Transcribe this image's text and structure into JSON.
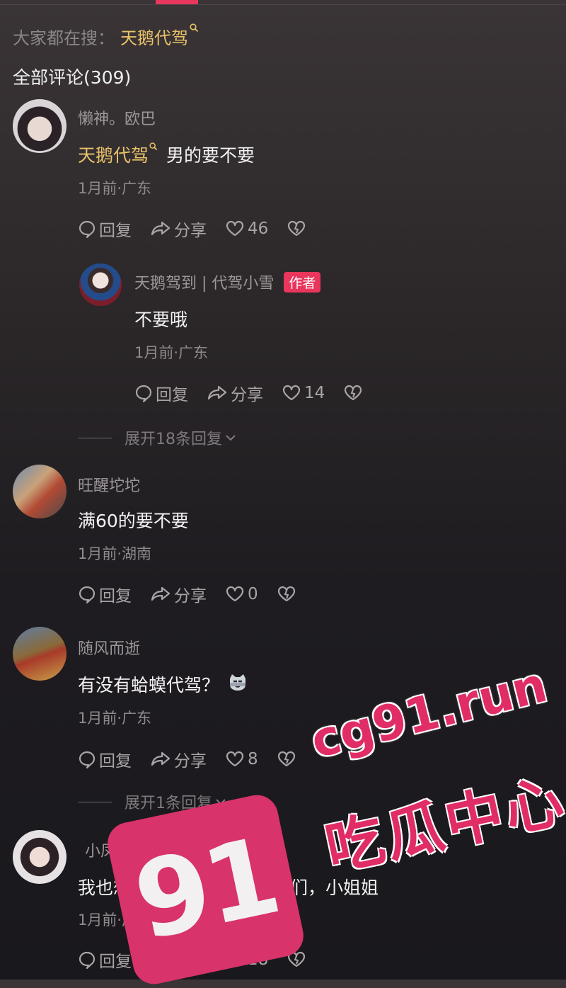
{
  "search": {
    "prefix": "大家都在搜：",
    "keyword": "天鹅代驾"
  },
  "comments_count": "全部评论(309)",
  "labels": {
    "reply": "回复",
    "share": "分享"
  },
  "comments": [
    {
      "user": "懒神。欧巴",
      "keyword": "天鹅代驾",
      "text": "男的要不要",
      "meta": "1月前·广东",
      "likes": "46"
    },
    {
      "user": "天鹅驾到 | 代驾小雪",
      "badge": "作者",
      "text": "不要哦",
      "meta": "1月前·广东",
      "likes": "14"
    },
    {
      "user": "旺醒坨坨",
      "text": "满60的要不要",
      "meta": "1月前·湖南",
      "likes": "0"
    },
    {
      "user": "随风而逝",
      "text": "有没有蛤蟆代驾？",
      "meta": "1月前·广东",
      "likes": "8"
    },
    {
      "user": "小凤",
      "text": "我也想做代驾，怎么加入你们，小姐姐",
      "meta": "1月前·广东",
      "likes": "18"
    }
  ],
  "expand": [
    "展开18条回复",
    "展开1条回复"
  ],
  "watermark": {
    "number": "91",
    "url": "cg91.run",
    "title": "吃瓜中心"
  },
  "icons": {
    "reply": "comment-bubble-icon",
    "share": "share-arrow-icon",
    "like": "heart-icon",
    "dislike": "broken-heart-icon"
  },
  "colors": {
    "keyword": "#e9c26a",
    "badge": "#e8365c",
    "watermark": "#e12d66"
  }
}
